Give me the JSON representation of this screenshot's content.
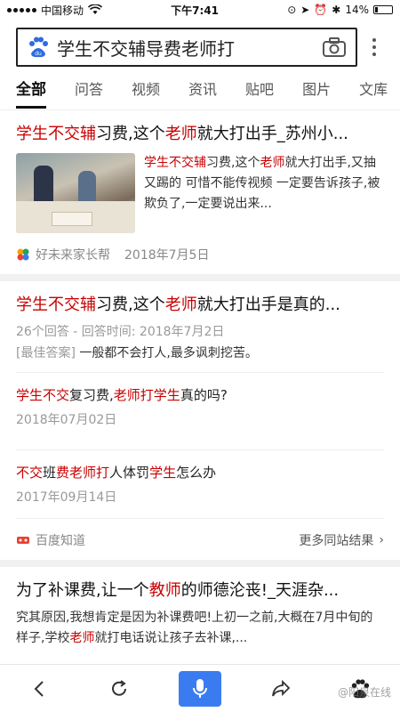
{
  "status": {
    "carrier": "中国移动",
    "time": "下午7:41",
    "battery": "14%"
  },
  "search": {
    "query": "学生不交辅导费老师打"
  },
  "tabs": [
    "全部",
    "问答",
    "视频",
    "资讯",
    "贴吧",
    "图片",
    "文库"
  ],
  "results": {
    "r1": {
      "title_hl1": "学生不交辅",
      "title_mid": "习费,这个",
      "title_hl2": "老师",
      "title_end": "就大打出手_苏州小...",
      "snip_hl1": "学生不交辅",
      "snip_mid": "习费,这个",
      "snip_hl2": "老师",
      "snip_end": "就大打出手,又抽又踢的 可惜不能传视频 一定要告诉孩子,被欺负了,一定要说出来...",
      "source": "好未来家长帮",
      "date": "2018年7月5日"
    },
    "r2": {
      "title_hl1": "学生不交辅",
      "title_mid": "习费,这个",
      "title_hl2": "老师",
      "title_end": "就大打出手是真的...",
      "meta": "26个回答 - 回答时间: 2018年7月2日",
      "best_tag": "[最佳答案]",
      "best_text": " 一般都不会打人,最多讽刺挖苦。",
      "q1_hl1": "学生不交",
      "q1_mid": "复习费,",
      "q1_hl2": "老师打学生",
      "q1_end": "真的吗?",
      "q1_date": "2018年07月02日",
      "q2_hl1": "不交",
      "q2_mid": "班",
      "q2_hl2": "费老师打",
      "q2_mid2": "人体罚",
      "q2_hl3": "学生",
      "q2_end": "怎么办",
      "q2_date": "2017年09月14日",
      "source": "百度知道",
      "more": "更多同站结果"
    },
    "r3": {
      "title_start": "为了补课费,让一个",
      "title_hl": "教师",
      "title_end": "的师德沦丧!_天涯杂...",
      "snip_start": "究其原因,我想肯定是因为补课费吧!上初一之前,大概在7月中旬的样子,学校",
      "snip_hl": "老师",
      "snip_end": "就打电话说让孩子去补课,..."
    }
  },
  "watermark": "@阳泉在线",
  "colors": {
    "highlight": "#c80000",
    "accent": "#3a7cf0"
  }
}
